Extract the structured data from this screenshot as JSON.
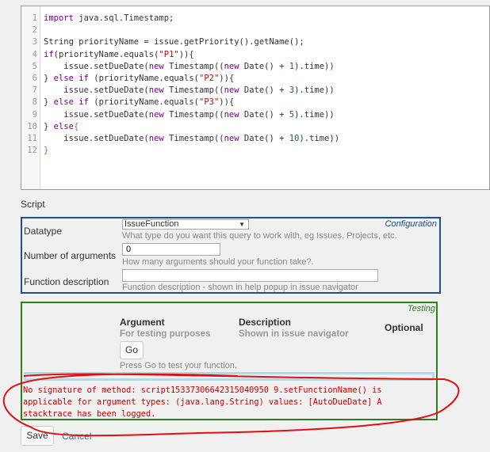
{
  "code_lines": [
    [
      [
        "import",
        "kw"
      ],
      [
        " java.sql.Timestamp;",
        ""
      ]
    ],
    [],
    [
      [
        "String priorityName = issue.getPriority().getName();",
        ""
      ]
    ],
    [
      [
        "if",
        "kw"
      ],
      [
        "(priorityName.equals(",
        ""
      ],
      [
        "\"P1\"",
        "str"
      ],
      [
        ")){",
        ""
      ]
    ],
    [
      [
        "    issue.setDueDate(",
        ""
      ],
      [
        "new",
        "kw"
      ],
      [
        " Timestamp((",
        ""
      ],
      [
        "new",
        "kw"
      ],
      [
        " Date() + ",
        ""
      ],
      [
        "1",
        "n"
      ],
      [
        ").time))",
        ""
      ]
    ],
    [
      [
        "} ",
        ""
      ],
      [
        "else if",
        "kw"
      ],
      [
        " (priorityName.equals(",
        ""
      ],
      [
        "\"P2\"",
        "str"
      ],
      [
        ")){",
        ""
      ]
    ],
    [
      [
        "    issue.setDueDate(",
        ""
      ],
      [
        "new",
        "kw"
      ],
      [
        " Timestamp((",
        ""
      ],
      [
        "new",
        "kw"
      ],
      [
        " Date() + ",
        ""
      ],
      [
        "3",
        "n"
      ],
      [
        ").time))",
        ""
      ]
    ],
    [
      [
        "} ",
        ""
      ],
      [
        "else if",
        "kw"
      ],
      [
        " (priorityName.equals(",
        ""
      ],
      [
        "\"P3\"",
        "str"
      ],
      [
        ")){",
        ""
      ]
    ],
    [
      [
        "    issue.setDueDate(",
        ""
      ],
      [
        "new",
        "kw"
      ],
      [
        " Timestamp((",
        ""
      ],
      [
        "new",
        "kw"
      ],
      [
        " Date() + ",
        ""
      ],
      [
        "5",
        "n"
      ],
      [
        ").time))",
        ""
      ]
    ],
    [
      [
        "} ",
        ""
      ],
      [
        "else",
        "kw"
      ],
      [
        "{",
        "br"
      ]
    ],
    [
      [
        "    issue.setDueDate(",
        ""
      ],
      [
        "new",
        "kw"
      ],
      [
        " Timestamp((",
        ""
      ],
      [
        "new",
        "kw"
      ],
      [
        " Date() + ",
        ""
      ],
      [
        "10",
        "n"
      ],
      [
        ").time))",
        ""
      ]
    ],
    [
      [
        "}",
        "br"
      ]
    ]
  ],
  "script_label": "Script",
  "config": {
    "title": "Configuration",
    "datatype_label": "Datatype",
    "datatype_value": "IssueFunction",
    "datatype_hint": "What type do you want this query to work with, eg Issues, Projects, etc.",
    "args_label": "Number of arguments",
    "args_value": "0",
    "args_hint": "How many arguments should your function take?.",
    "desc_label": "Function description",
    "desc_value": "",
    "desc_hint": "Function description - shown in help popup in issue navigator"
  },
  "testing": {
    "title": "Testing",
    "col_argument": "Argument",
    "col_argument_sub": "For testing purposes",
    "col_description": "Description",
    "col_description_sub": "Shown in issue navigator",
    "col_optional": "Optional",
    "go_label": "Go",
    "go_hint": "Press Go to test your function.",
    "error": "No signature of method: script15337306642315040950 9.setFunctionName() is applicable for argument types: (java.lang.String) values: [AutoDueDate] A stacktrace has been logged."
  },
  "actions": {
    "save": "Save",
    "cancel": "Cancel"
  }
}
